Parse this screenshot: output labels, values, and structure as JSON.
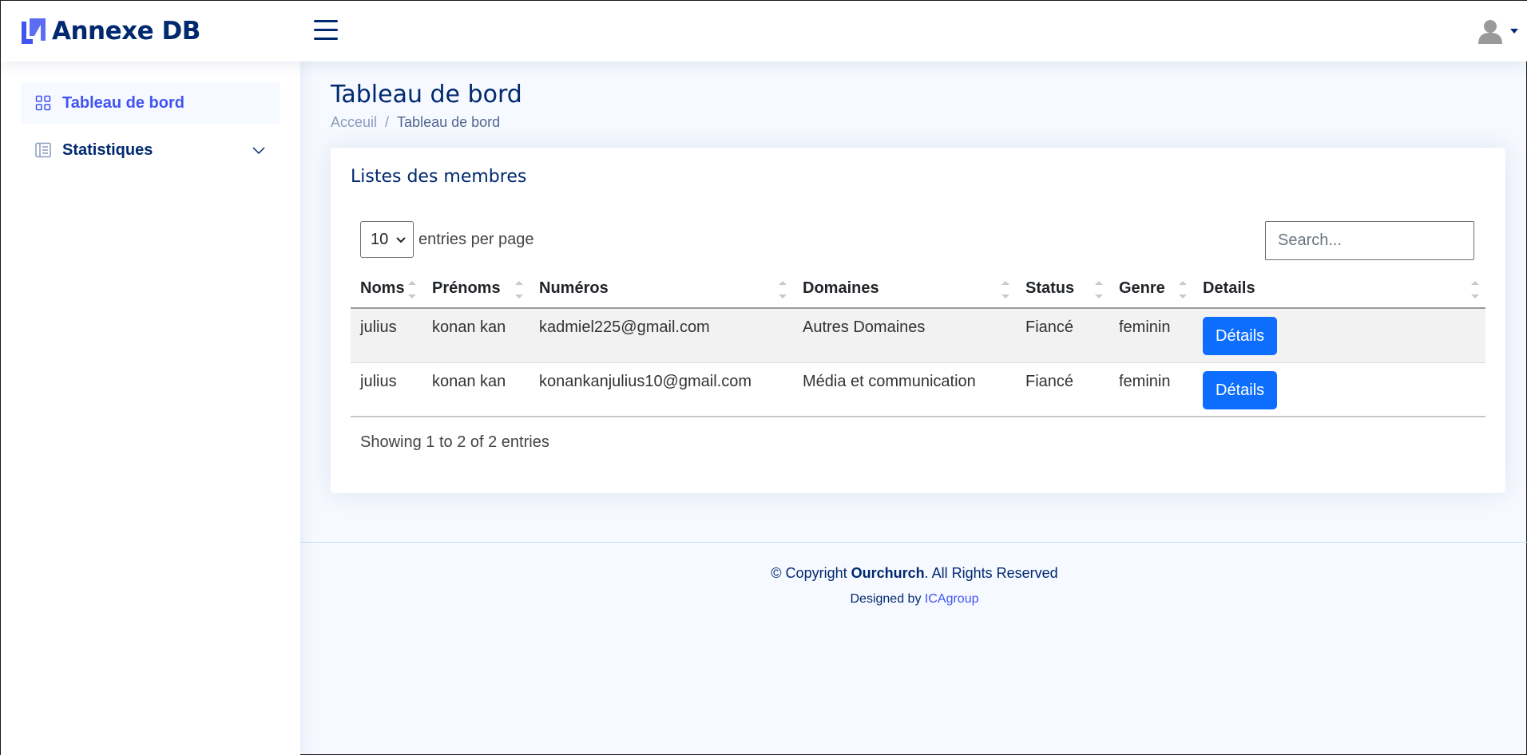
{
  "brand": {
    "name": "Annexe DB",
    "logo_icon": "annexe-logo-icon",
    "accent": "#4154f1",
    "navy": "#012970"
  },
  "header": {
    "menu_icon": "hamburger-icon",
    "avatar_icon": "user-avatar-icon"
  },
  "sidebar": {
    "items": [
      {
        "label": "Tableau de bord",
        "icon": "grid-icon",
        "active": true
      },
      {
        "label": "Statistiques",
        "icon": "layout-text-icon",
        "active": false
      }
    ]
  },
  "page": {
    "title": "Tableau de bord",
    "breadcrumb": {
      "home": "Acceuil",
      "separator": "/",
      "current": "Tableau de bord"
    }
  },
  "card": {
    "title": "Listes des membres",
    "per_page_value": "10",
    "per_page_label": "entries per page",
    "search_placeholder": "Search...",
    "columns": [
      "Noms",
      "Prénoms",
      "Numéros",
      "Domaines",
      "Status",
      "Genre",
      "Details"
    ],
    "rows": [
      {
        "nom": "julius",
        "prenom": "konan kan",
        "numero": "kadmiel225@gmail.com",
        "domaine": "Autres Domaines",
        "status": "Fiancé",
        "genre": "feminin",
        "action": "Détails"
      },
      {
        "nom": "julius",
        "prenom": "konan kan",
        "numero": "konankanjulius10@gmail.com",
        "domaine": "Média et communication",
        "status": "Fiancé",
        "genre": "feminin",
        "action": "Détails"
      }
    ],
    "info": "Showing 1 to 2 of 2 entries",
    "button_color": "#0d6efd"
  },
  "footer": {
    "copyright_prefix": "© Copyright ",
    "copyright_brand": "Ourchurch",
    "copyright_suffix": ". All Rights Reserved",
    "designed_prefix": "Designed by ",
    "designed_link": "ICAgroup"
  }
}
